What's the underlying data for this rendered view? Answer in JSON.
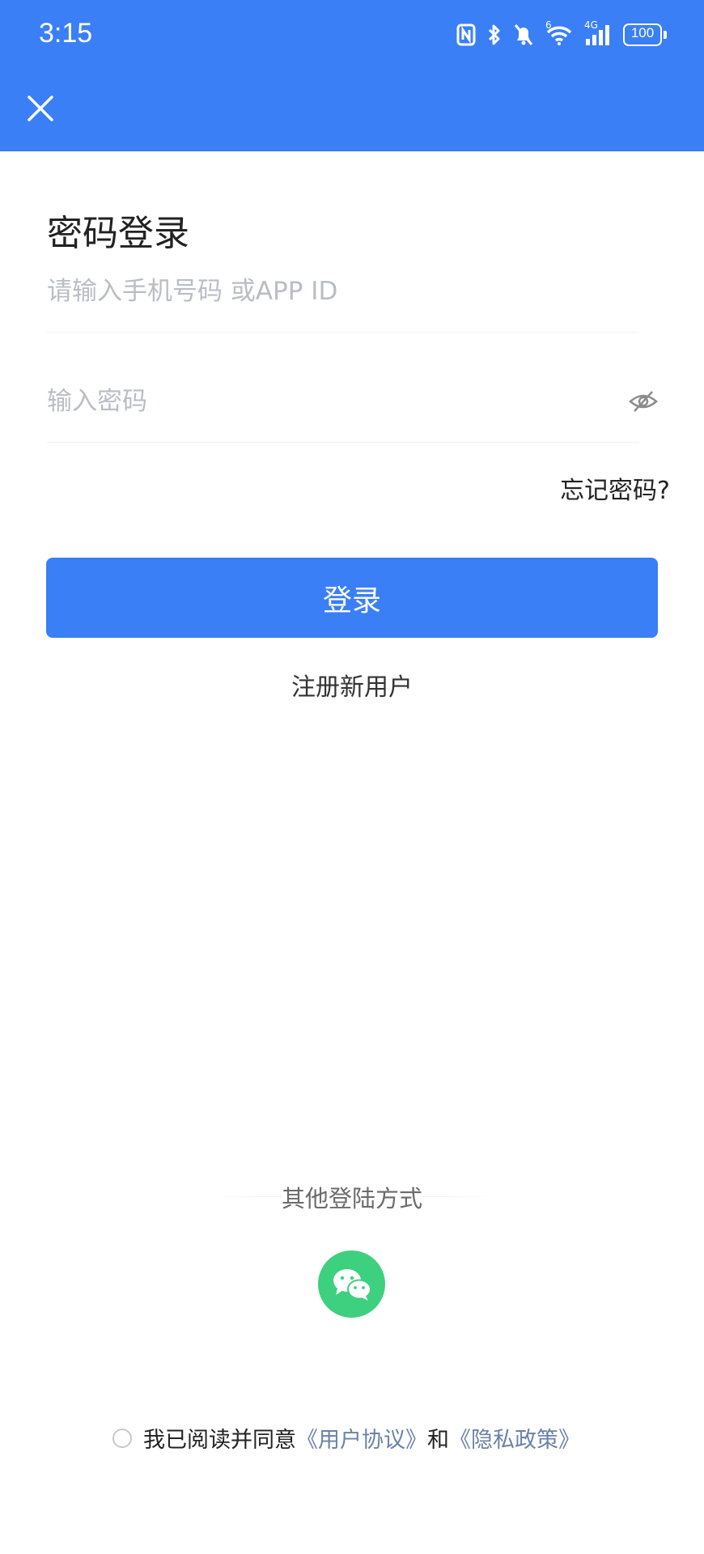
{
  "status_bar": {
    "time": "3:15",
    "battery": "100",
    "network": "4G",
    "wifi_sup": "6",
    "icons": [
      "nfc-icon",
      "bluetooth-icon",
      "mute-bell-icon",
      "wifi-icon",
      "signal-icon",
      "battery-icon"
    ]
  },
  "header": {
    "close_icon": "close-icon",
    "bg_color": "#3a7ff5"
  },
  "login": {
    "title": "密码登录",
    "phone_placeholder": "请输入手机号码 或APP ID",
    "password_placeholder": "输入密码",
    "eye_icon": "eye-hidden-icon",
    "forgot": "忘记密码?",
    "submit": "登录",
    "register": "注册新用户"
  },
  "other": {
    "label": "其他登陆方式",
    "wechat_icon": "wechat-icon",
    "wechat_color": "#3dd07e"
  },
  "agreement": {
    "prefix": "我已阅读并同意",
    "user_agreement": "《用户协议》",
    "and": "和",
    "privacy": "《隐私政策》",
    "checked": false
  }
}
